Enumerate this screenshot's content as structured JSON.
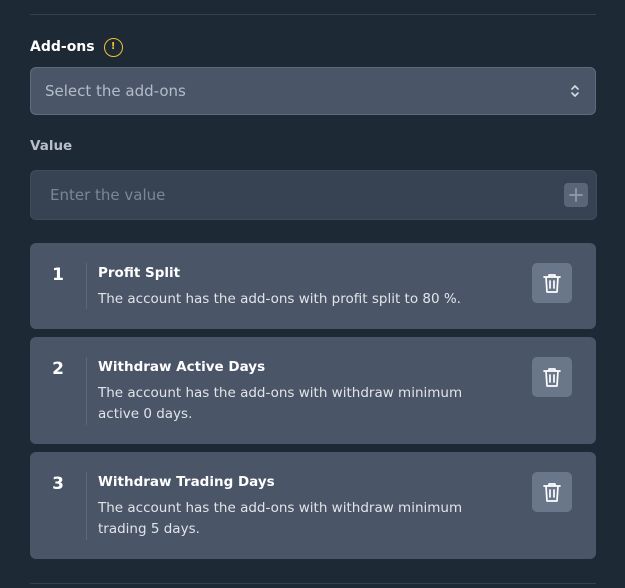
{
  "addons": {
    "label": "Add-ons",
    "info_icon": "!",
    "select_placeholder": "Select the add-ons"
  },
  "value": {
    "label": "Value",
    "placeholder": "Enter the value"
  },
  "items": [
    {
      "index": "1",
      "title": "Profit Split",
      "description": "The account has the add-ons with profit split to 80 %."
    },
    {
      "index": "2",
      "title": "Withdraw Active Days",
      "description": "The account has the add-ons with withdraw minimum active 0 days."
    },
    {
      "index": "3",
      "title": "Withdraw Trading Days",
      "description": "The account has the add-ons with withdraw minimum trading 5 days."
    }
  ],
  "colors": {
    "background": "#1e2936",
    "card": "#4a5568",
    "warning": "#f2c12e"
  }
}
